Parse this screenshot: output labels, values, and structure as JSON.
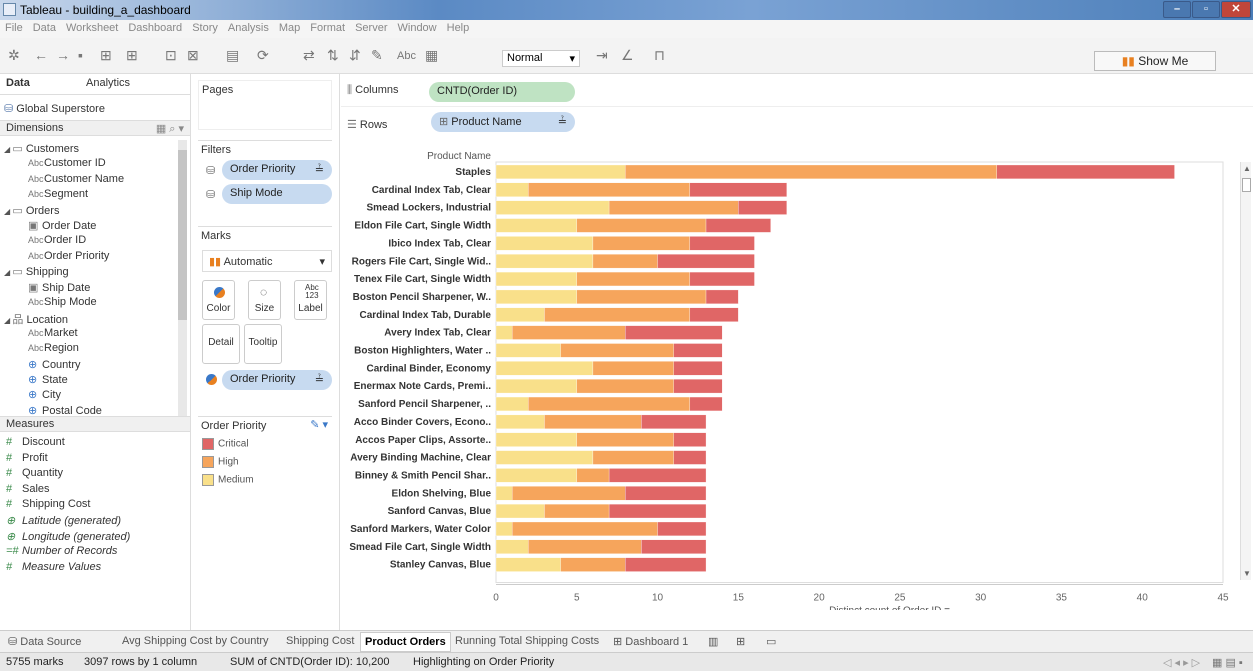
{
  "window": {
    "title": "Tableau - building_a_dashboard"
  },
  "menu": [
    "File",
    "Data",
    "Worksheet",
    "Dashboard",
    "Story",
    "Analysis",
    "Map",
    "Format",
    "Server",
    "Window",
    "Help"
  ],
  "toolbar": {
    "mark_size": "Normal",
    "showme": "Show Me"
  },
  "data_pane": {
    "tab_data": "Data",
    "tab_analytics": "Analytics",
    "datasource": "Global Superstore",
    "dimensions_label": "Dimensions",
    "measures_label": "Measures",
    "dimensions": [
      {
        "kind": "folder",
        "label": "Customers"
      },
      {
        "kind": "Abc",
        "label": "Customer ID"
      },
      {
        "kind": "Abc",
        "label": "Customer Name"
      },
      {
        "kind": "Abc",
        "label": "Segment"
      },
      {
        "kind": "folder",
        "label": "Orders"
      },
      {
        "kind": "date",
        "label": "Order Date"
      },
      {
        "kind": "Abc",
        "label": "Order ID"
      },
      {
        "kind": "Abc",
        "label": "Order Priority"
      },
      {
        "kind": "folder",
        "label": "Shipping"
      },
      {
        "kind": "date",
        "label": "Ship Date"
      },
      {
        "kind": "Abc",
        "label": "Ship Mode"
      },
      {
        "kind": "hier",
        "label": "Location"
      },
      {
        "kind": "Abc",
        "label": "Market"
      },
      {
        "kind": "Abc",
        "label": "Region"
      },
      {
        "kind": "geo",
        "label": "Country"
      },
      {
        "kind": "geo",
        "label": "State"
      },
      {
        "kind": "geo",
        "label": "City"
      },
      {
        "kind": "geo",
        "label": "Postal Code"
      }
    ],
    "measures": [
      {
        "kind": "#",
        "label": "Discount",
        "italic": false
      },
      {
        "kind": "#",
        "label": "Profit",
        "italic": false
      },
      {
        "kind": "#",
        "label": "Quantity",
        "italic": false
      },
      {
        "kind": "#",
        "label": "Sales",
        "italic": false
      },
      {
        "kind": "#",
        "label": "Shipping Cost",
        "italic": false
      },
      {
        "kind": "geo",
        "label": "Latitude (generated)",
        "italic": true
      },
      {
        "kind": "geo",
        "label": "Longitude (generated)",
        "italic": true
      },
      {
        "kind": "=#",
        "label": "Number of Records",
        "italic": true
      },
      {
        "kind": "#",
        "label": "Measure Values",
        "italic": true
      }
    ]
  },
  "cards": {
    "pages": "Pages",
    "filters": "Filters",
    "filter_pills": [
      "Order Priority",
      "Ship Mode"
    ],
    "marks": "Marks",
    "mark_type": "Automatic",
    "mark_buttons": [
      "Color",
      "Size",
      "Label",
      "Detail",
      "Tooltip"
    ],
    "marks_pill": "Order Priority",
    "legend_title": "Order Priority",
    "legend": [
      {
        "label": "Critical",
        "color": "#e06666"
      },
      {
        "label": "High",
        "color": "#f6a55c"
      },
      {
        "label": "Medium",
        "color": "#f9e08a"
      }
    ]
  },
  "shelves": {
    "columns_label": "Columns",
    "columns_pill": "CNTD(Order ID)",
    "rows_label": "Rows",
    "rows_pill": "Product Name"
  },
  "chart_data": {
    "type": "bar",
    "orientation": "horizontal-stacked",
    "header": "Product Name",
    "xlabel": "Distinct count of Order ID",
    "xlim": [
      0,
      45
    ],
    "xticks": [
      0,
      5,
      10,
      15,
      20,
      25,
      30,
      35,
      40,
      45
    ],
    "series_order": [
      "Medium",
      "High",
      "Critical"
    ],
    "colors": {
      "Medium": "#f9e08a",
      "High": "#f6a55c",
      "Critical": "#e06666"
    },
    "categories": [
      "Staples",
      "Cardinal Index Tab, Clear",
      "Smead Lockers, Industrial",
      "Eldon File Cart, Single Width",
      "Ibico Index Tab, Clear",
      "Rogers File Cart, Single Wid..",
      "Tenex File Cart, Single Width",
      "Boston Pencil Sharpener, W..",
      "Cardinal Index Tab, Durable",
      "Avery Index Tab, Clear",
      "Boston Highlighters, Water ..",
      "Cardinal Binder, Economy",
      "Enermax Note Cards, Premi..",
      "Sanford Pencil Sharpener, ..",
      "Acco Binder Covers, Econo..",
      "Accos Paper Clips, Assorte..",
      "Avery Binding Machine, Clear",
      "Binney & Smith Pencil Shar..",
      "Eldon Shelving, Blue",
      "Sanford Canvas, Blue",
      "Sanford Markers, Water Color",
      "Smead File Cart, Single Width",
      "Stanley Canvas, Blue"
    ],
    "series": [
      {
        "name": "Medium",
        "values": [
          8,
          2,
          7,
          5,
          6,
          6,
          5,
          5,
          3,
          1,
          4,
          6,
          5,
          2,
          3,
          5,
          6,
          5,
          1,
          3,
          1,
          2,
          4
        ]
      },
      {
        "name": "High",
        "values": [
          23,
          10,
          8,
          8,
          6,
          4,
          7,
          8,
          9,
          7,
          7,
          5,
          6,
          10,
          6,
          6,
          5,
          2,
          7,
          4,
          9,
          7,
          4
        ]
      },
      {
        "name": "Critical",
        "values": [
          11,
          6,
          3,
          4,
          4,
          6,
          4,
          2,
          3,
          6,
          3,
          3,
          3,
          2,
          4,
          2,
          2,
          6,
          5,
          6,
          3,
          4,
          5
        ]
      }
    ]
  },
  "sheet_tabs": [
    "Data Source",
    "Avg Shipping Cost by Country",
    "Shipping Cost",
    "Product Orders",
    "Running Total Shipping Costs",
    "Dashboard 1"
  ],
  "active_tab": "Product Orders",
  "status": {
    "marks": "5755 marks",
    "rows": "3097 rows by 1 column",
    "sum": "SUM of CNTD(Order ID): 10,200",
    "highlight": "Highlighting on Order Priority"
  }
}
